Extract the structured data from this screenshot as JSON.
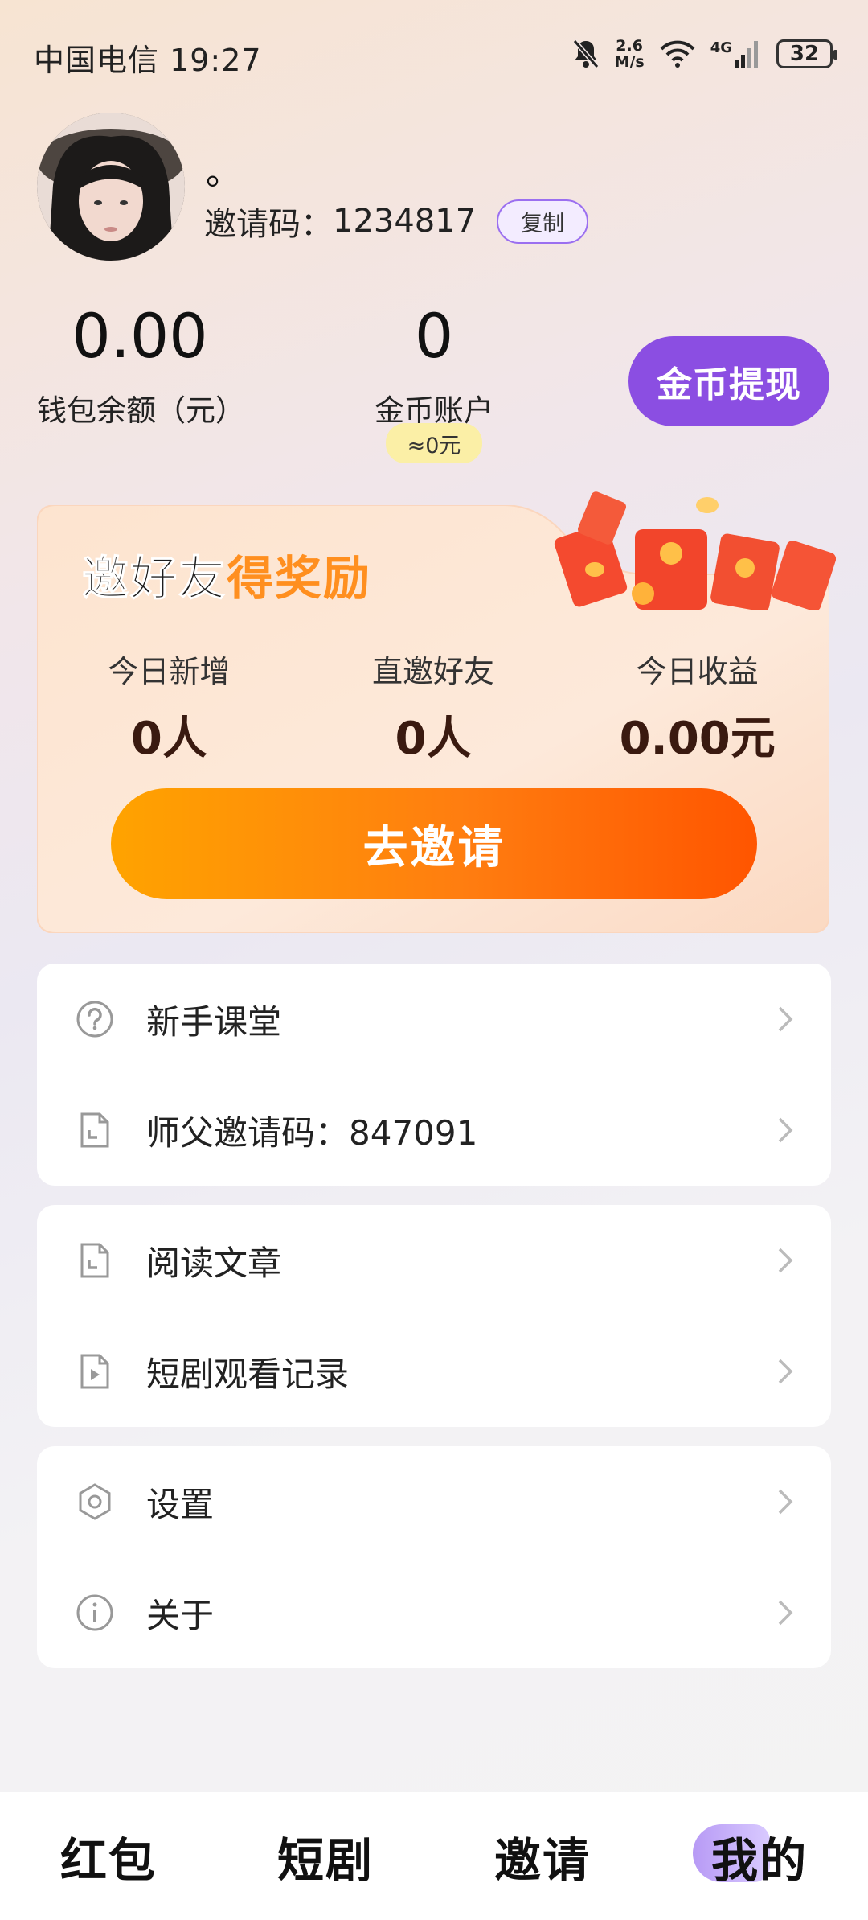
{
  "status_bar": {
    "carrier_time": "中国电信 19:27",
    "net_speed_value": "2.6",
    "net_speed_unit": "M/s",
    "network_type": "4G",
    "battery": "32",
    "icons": [
      "bell-off-icon",
      "wifi-icon",
      "signal-icon",
      "battery-icon"
    ]
  },
  "profile": {
    "nickname": "。",
    "invite_code_label": "邀请码：",
    "invite_code": "1234817",
    "copy_label": "复制"
  },
  "stats": {
    "wallet_value": "0.00",
    "wallet_label": "钱包余额（元）",
    "coin_value": "0",
    "coin_label": "金币账户",
    "coin_equiv": "≈0元",
    "withdraw_label": "金币提现"
  },
  "invite_card": {
    "title_part1": "邀好友",
    "title_part2": "得奖励",
    "stats": [
      {
        "label": "今日新增",
        "value": "0人"
      },
      {
        "label": "直邀好友",
        "value": "0人"
      },
      {
        "label": "今日收益",
        "value": "0.00元"
      }
    ],
    "button_label": "去邀请"
  },
  "menu_groups": [
    [
      {
        "icon": "question-icon",
        "label": "新手课堂"
      },
      {
        "icon": "document-icon",
        "label": "师父邀请码：847091"
      }
    ],
    [
      {
        "icon": "document-icon",
        "label": "阅读文章"
      },
      {
        "icon": "video-file-icon",
        "label": "短剧观看记录"
      }
    ],
    [
      {
        "icon": "hexagon-settings-icon",
        "label": "设置"
      },
      {
        "icon": "info-icon",
        "label": "关于"
      }
    ]
  ],
  "bottom_nav": {
    "items": [
      "红包",
      "短剧",
      "邀请",
      "我的"
    ],
    "active": "我的"
  },
  "colors": {
    "accent_purple": "#8b4ee2",
    "invite_orange": "#ff7d10",
    "title_orange": "#ff8f1f"
  }
}
